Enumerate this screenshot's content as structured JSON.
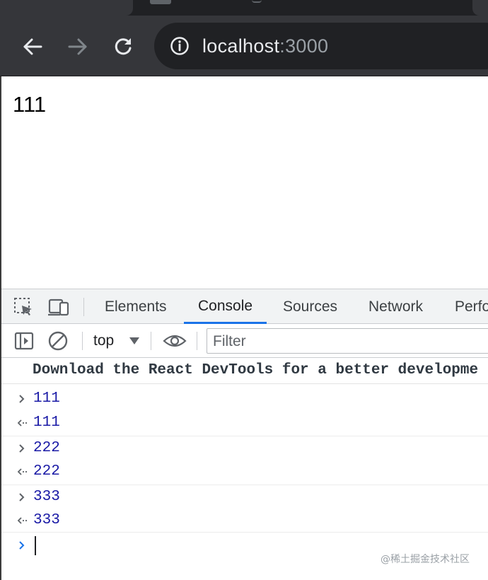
{
  "browser": {
    "url_host": "localhost",
    "url_port": ":3000"
  },
  "page": {
    "content_text": "111"
  },
  "devtools": {
    "tabs": [
      {
        "label": "Elements",
        "active": false
      },
      {
        "label": "Console",
        "active": true
      },
      {
        "label": "Sources",
        "active": false
      },
      {
        "label": "Network",
        "active": false
      },
      {
        "label": "Perfo",
        "active": false
      }
    ],
    "context": "top",
    "filter_placeholder": "Filter",
    "accent_color": "#1a73e8"
  },
  "console": {
    "info_message": "Download the React DevTools for a better developme",
    "entries": [
      {
        "kind": "input",
        "value": "111"
      },
      {
        "kind": "result",
        "value": "111"
      },
      {
        "kind": "input",
        "value": "222"
      },
      {
        "kind": "result",
        "value": "222"
      },
      {
        "kind": "input",
        "value": "333"
      },
      {
        "kind": "result",
        "value": "333"
      }
    ],
    "value_color": "#1a1aa6"
  },
  "watermark": "@稀土掘金技术社区"
}
